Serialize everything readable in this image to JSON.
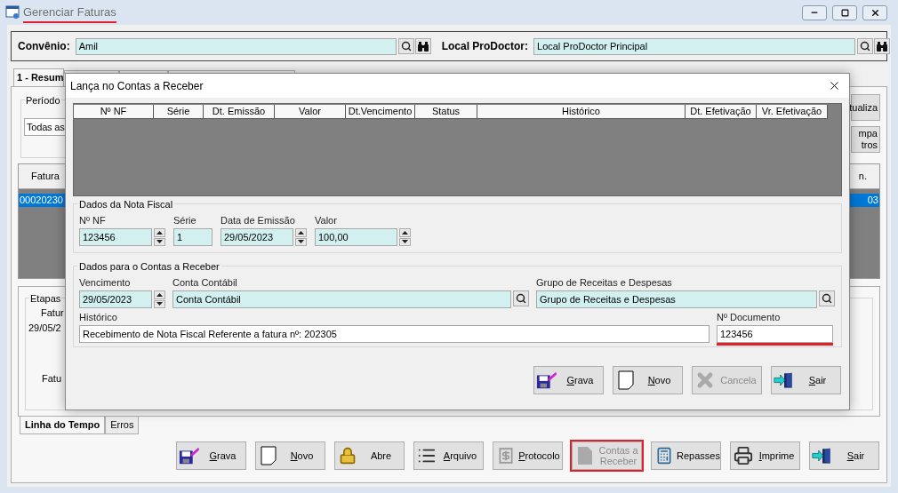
{
  "window": {
    "title": "Gerenciar Faturas",
    "marked": true
  },
  "filters": [
    {
      "label": "Convênio:",
      "value": "Amil"
    },
    {
      "label": "Local ProDoctor:",
      "value": "Local ProDoctor Principal"
    }
  ],
  "tabs": [
    {
      "label": "1 - Resum",
      "selected": true
    },
    {
      "selected": false
    },
    {
      "selected": false
    },
    {
      "selected": false
    }
  ],
  "period": {
    "title": "Período",
    "value": "Todas as"
  },
  "side_buttons": [
    {
      "lines": [
        "tualiza"
      ]
    },
    {
      "lines": [
        "mpa",
        "tros"
      ]
    }
  ],
  "invoices": {
    "columns": [
      "Fatura",
      "n."
    ],
    "rows": [
      {
        "cells": [
          "00020230",
          "03"
        ],
        "selected": true
      }
    ]
  },
  "stages": {
    "title": "Etapas",
    "texts": [
      "Fatur",
      "29/05/2",
      "Fatu"
    ]
  },
  "bottom_tabs": [
    {
      "label": "Linha do Tempo",
      "selected": true
    },
    {
      "label": "Erros",
      "selected": false
    }
  ],
  "toolbar": [
    {
      "label": "Grava",
      "key_underlined": true,
      "disabled": false,
      "marked": false
    },
    {
      "label": "Novo",
      "key_underlined": true,
      "disabled": false,
      "marked": false
    },
    {
      "label": "Abre",
      "key_underlined": false,
      "disabled": false,
      "marked": false
    },
    {
      "label": "Arquivo",
      "key_underlined": true,
      "disabled": false,
      "marked": false
    },
    {
      "label": "Protocolo",
      "key_underlined": true,
      "disabled": false,
      "marked": false
    },
    {
      "label": "Contas a Receber",
      "key_underlined": false,
      "disabled": true,
      "marked": true
    },
    {
      "label": "Repasses",
      "key_underlined": false,
      "disabled": false,
      "marked": false
    },
    {
      "label": "Imprime",
      "key_underlined": true,
      "disabled": false,
      "marked": false
    },
    {
      "label": "Sair",
      "key_underlined": true,
      "disabled": false,
      "marked": false
    }
  ],
  "dialog": {
    "title": "Lança no Contas a Receber",
    "columns": [
      "Nº NF",
      "Série",
      "Dt. Emissão",
      "Valor",
      "Dt.Vencimento",
      "Status",
      "Histórico",
      "Dt. Efetivação",
      "Vr. Efetivação"
    ],
    "nf_group": {
      "title": "Dados da Nota Fiscal",
      "fields": [
        {
          "label": "Nº NF",
          "value": "123456",
          "kind": "spinner"
        },
        {
          "label": "Série",
          "value": "1",
          "kind": "display"
        },
        {
          "label": "Data de Emissão",
          "value": "29/05/2023",
          "kind": "spinner"
        },
        {
          "label": "Valor",
          "value": "100,00",
          "kind": "spinner"
        }
      ]
    },
    "receivable_group": {
      "title": "Dados para o Contas a Receber",
      "rows": [
        {
          "fields": [
            {
              "label": "Vencimento",
              "value": "29/05/2023",
              "kind": "spinner",
              "marked": false
            },
            {
              "label": "Conta Contábil",
              "value": "Conta Contábil",
              "kind": "lookup",
              "marked": false
            },
            {
              "label": "Grupo de Receitas e Despesas",
              "value": "Grupo de Receitas e Despesas",
              "kind": "lookup",
              "marked": false
            }
          ]
        },
        {
          "fields": [
            {
              "label": "Histórico",
              "value": "Recebimento de Nota Fiscal Referente a fatura nº: 202305",
              "kind": "entry",
              "marked": false
            },
            {
              "label": "Nº Documento",
              "value": "123456",
              "kind": "entry",
              "marked": true
            }
          ]
        }
      ]
    },
    "buttons": [
      {
        "label": "Grava",
        "key_underlined": true,
        "disabled": false
      },
      {
        "label": "Novo",
        "key_underlined": true,
        "disabled": false
      },
      {
        "label": "Cancela",
        "key_underlined": false,
        "disabled": true
      },
      {
        "label": "Sair",
        "key_underlined": true,
        "disabled": false
      }
    ]
  }
}
